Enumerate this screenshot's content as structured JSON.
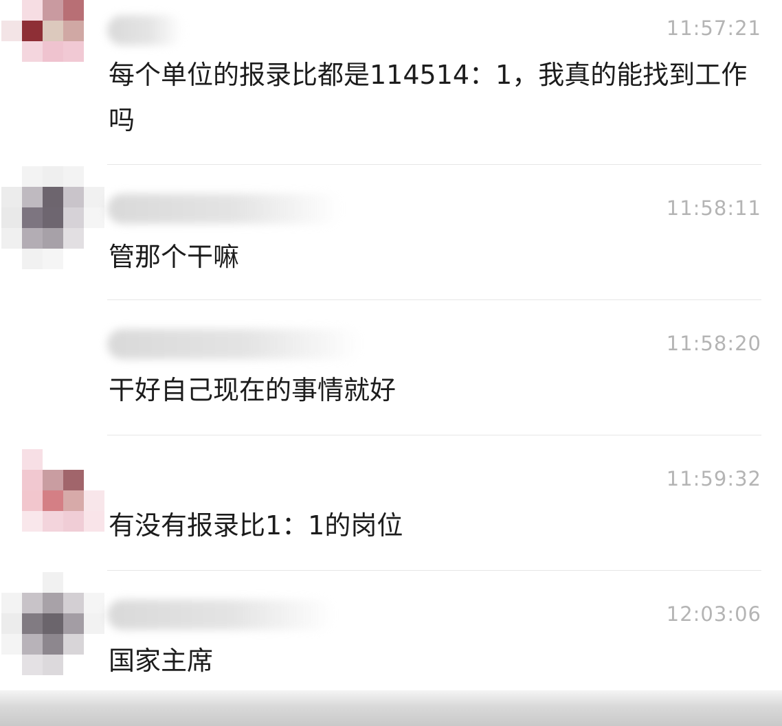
{
  "messages": [
    {
      "time": "11:57:21",
      "text": "每个单位的报录比都是114514：1，我真的能找到工作吗",
      "avatar_colors": [
        "#ffffff",
        "#f6dde3",
        "#c99aa0",
        "#b86f75",
        "#ffffff",
        "#f3e4e6",
        "#8e2f36",
        "#dcc9bd",
        "#d0a8a4",
        "#ffffff",
        "#ffffff",
        "#f4d6de",
        "#efc3cf",
        "#f1c9d4",
        "#ffffff",
        "#ffffff",
        "#ffffff",
        "#ffffff",
        "#ffffff",
        "#ffffff",
        "#ffffff",
        "#ffffff",
        "#ffffff",
        "#ffffff",
        "#ffffff"
      ]
    },
    {
      "time": "11:58:11",
      "text": "管那个干嘛",
      "avatar_colors": [
        "#ffffff",
        "#f3f3f3",
        "#efefef",
        "#f3f3f3",
        "#ffffff",
        "#ececec",
        "#bfbac0",
        "#6d656e",
        "#c9c4ca",
        "#f1f1f1",
        "#e9e9e9",
        "#7d7580",
        "#6e6670",
        "#d6d2d7",
        "#f5f5f5",
        "#f0f0f0",
        "#b3adb4",
        "#a7a1a8",
        "#e2dfe2",
        "#ffffff",
        "#ffffff",
        "#f1f1f1",
        "#f5f5f5",
        "#ffffff",
        "#ffffff"
      ]
    },
    {
      "time": "11:58:20",
      "text": "干好自己现在的事情就好",
      "avatar_colors": [
        "#ffffff",
        "#ffffff",
        "#ffffff",
        "#ffffff",
        "#ffffff",
        "#ffffff",
        "#ffffff",
        "#ffffff",
        "#ffffff",
        "#ffffff",
        "#ffffff",
        "#ffffff",
        "#ffffff",
        "#ffffff",
        "#ffffff",
        "#ffffff",
        "#ffffff",
        "#ffffff",
        "#ffffff",
        "#ffffff",
        "#ffffff",
        "#ffffff",
        "#ffffff",
        "#ffffff",
        "#ffffff"
      ]
    },
    {
      "time": "11:59:32",
      "text": "有没有报录比1：1的岗位",
      "avatar_colors": [
        "#ffffff",
        "#f7dfe5",
        "#ffffff",
        "#ffffff",
        "#ffffff",
        "#ffffff",
        "#f1c8d0",
        "#c99da1",
        "#a1656b",
        "#ffffff",
        "#ffffff",
        "#f2c6cd",
        "#d47f85",
        "#d7aaa9",
        "#f8e6ea",
        "#ffffff",
        "#f9e7eb",
        "#f3d4dc",
        "#f0cdd6",
        "#f9e4e9",
        "#ffffff",
        "#ffffff",
        "#ffffff",
        "#ffffff",
        "#ffffff"
      ]
    },
    {
      "time": "12:03:06",
      "text": "国家主席",
      "avatar_colors": [
        "#ffffff",
        "#ffffff",
        "#f1f1f1",
        "#ffffff",
        "#ffffff",
        "#f3f3f3",
        "#c8c3c8",
        "#a8a2a8",
        "#d3cfd3",
        "#f5f5f5",
        "#ececec",
        "#817b82",
        "#6b656c",
        "#a39da4",
        "#f2f2f2",
        "#f4f4f4",
        "#b8b3b9",
        "#8d878e",
        "#d8d5d8",
        "#ffffff",
        "#ffffff",
        "#e4e1e4",
        "#dcd9dc",
        "#ffffff",
        "#ffffff"
      ]
    }
  ]
}
